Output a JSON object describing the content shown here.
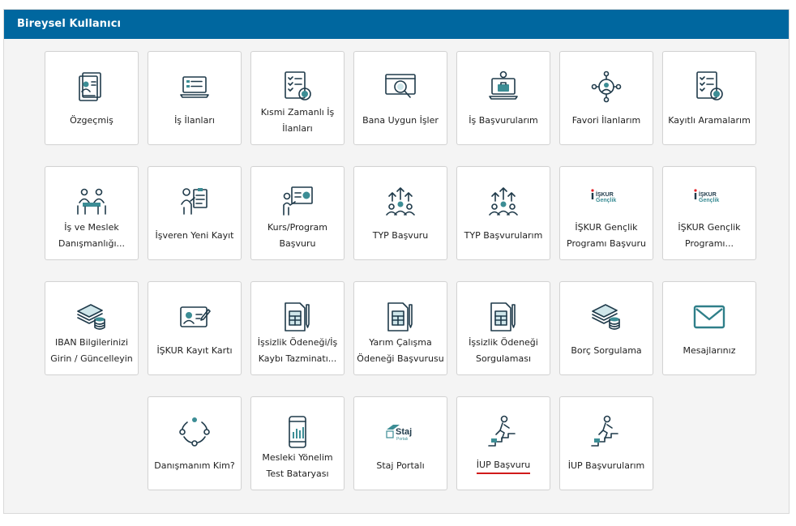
{
  "panel": {
    "title": "Bireysel Kullanıcı"
  },
  "tiles": [
    {
      "label": "Özgeçmiş",
      "icon": "resume-icon"
    },
    {
      "label": "İş İlanları",
      "icon": "job-listings-icon"
    },
    {
      "label": "Kısmi Zamanlı İş İlanları",
      "icon": "part-time-checklist-icon"
    },
    {
      "label": "Bana Uygun İşler",
      "icon": "search-browser-icon"
    },
    {
      "label": "İş Başvurularım",
      "icon": "applications-laptop-icon"
    },
    {
      "label": "Favori İlanlarım",
      "icon": "favorite-network-icon"
    },
    {
      "label": "Kayıtlı Aramalarım",
      "icon": "saved-search-checklist-icon"
    },
    {
      "label": "İş ve Meslek Danışmanlığı...",
      "icon": "counseling-meeting-icon"
    },
    {
      "label": "İşveren Yeni Kayıt",
      "icon": "employer-register-icon"
    },
    {
      "label": "Kurs/Program Başvuru",
      "icon": "course-presentation-icon"
    },
    {
      "label": "TYP Başvuru",
      "icon": "typ-group-icon"
    },
    {
      "label": "TYP Başvurularım",
      "icon": "typ-group-icon"
    },
    {
      "label": "İŞKUR Gençlik Programı Başvuru",
      "icon": "iskur-genclik-logo-icon"
    },
    {
      "label": "İŞKUR Gençlik Programı...",
      "icon": "iskur-genclik-logo-icon"
    },
    {
      "label": "IBAN Bilgilerinizi Girin / Güncelleyin",
      "icon": "money-coins-icon"
    },
    {
      "label": "İŞKUR Kayıt Kartı",
      "icon": "id-card-icon"
    },
    {
      "label": "İşsizlik Ödeneği/İş Kaybı Tazminatı...",
      "icon": "calculator-document-icon"
    },
    {
      "label": "Yarım Çalışma Ödeneği Başvurusu",
      "icon": "calculator-document-icon"
    },
    {
      "label": "İşsizlik Ödeneği Sorgulaması",
      "icon": "calculator-document-icon"
    },
    {
      "label": "Borç Sorgulama",
      "icon": "money-coins-icon"
    },
    {
      "label": "Mesajlarınız",
      "icon": "envelope-icon"
    },
    {
      "label": "Danışmanım Kim?",
      "icon": "advisor-cycle-icon"
    },
    {
      "label": "Mesleki Yönelim Test Bataryası",
      "icon": "mobile-chart-icon"
    },
    {
      "label": "Staj Portalı",
      "icon": "staj-portal-logo-icon"
    },
    {
      "label": "İUP Başvuru",
      "icon": "stairs-climber-icon",
      "active": true
    },
    {
      "label": "İUP Başvurularım",
      "icon": "stairs-climber-icon"
    }
  ],
  "logo_text": {
    "iskur_genclik": [
      "İŞKUR",
      "Gençlik"
    ],
    "staj": [
      "Staj",
      "Portalı"
    ]
  }
}
